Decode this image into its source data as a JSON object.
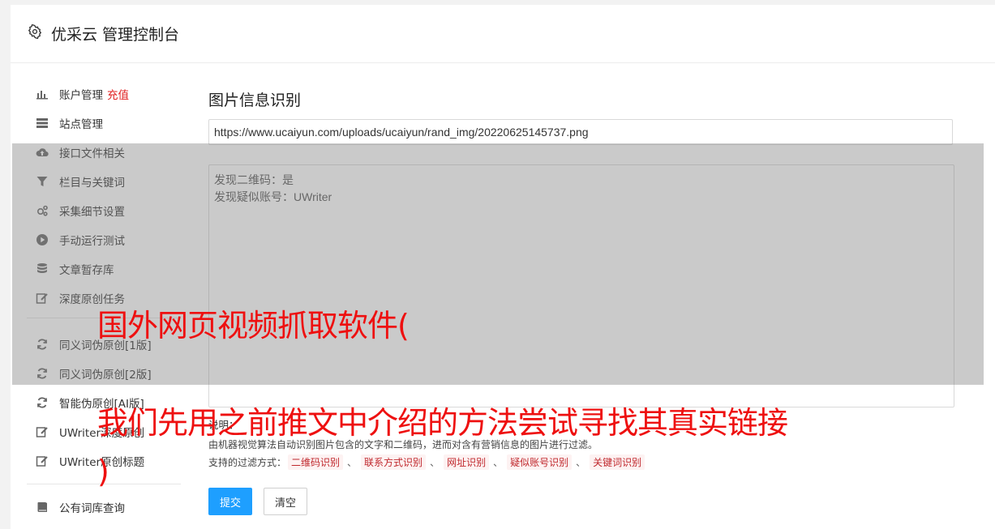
{
  "header": {
    "title": "优采云 管理控制台",
    "icon": "gear-icon"
  },
  "sidebar": {
    "items": [
      {
        "label": "账户管理",
        "badge": "充值",
        "icon": "bar-chart-icon"
      },
      {
        "label": "站点管理",
        "icon": "server-icon"
      },
      {
        "label": "接口文件相关",
        "icon": "cloud-upload-icon"
      },
      {
        "label": "栏目与关键词",
        "icon": "filter-icon"
      },
      {
        "label": "采集细节设置",
        "icon": "cogs-icon"
      },
      {
        "label": "手动运行测试",
        "icon": "play-circle-icon"
      },
      {
        "label": "文章暂存库",
        "icon": "database-icon"
      },
      {
        "label": "深度原创任务",
        "icon": "edit-icon"
      },
      {
        "label": "同义词伪原创[1版]",
        "icon": "refresh-icon"
      },
      {
        "label": "同义词伪原创[2版]",
        "icon": "refresh-icon"
      },
      {
        "label": "智能伪原创[AI版]",
        "icon": "refresh-icon"
      },
      {
        "label": "UWriter深度原创",
        "icon": "edit-icon"
      },
      {
        "label": "UWriter原创标题",
        "icon": "edit-icon"
      },
      {
        "label": "公有词库查询",
        "icon": "book-icon"
      }
    ]
  },
  "main": {
    "title": "图片信息识别",
    "url_value": "https://www.ucaiyun.com/uploads/ucaiyun/rand_img/20220625145737.png",
    "result_lines": [
      "发现二维码：是",
      "发现疑似账号：UWriter"
    ],
    "note_label": "说明：",
    "description": "由机器视觉算法自动识别图片包含的文字和二维码，进而对含有营销信息的图片进行过滤。",
    "filters_label": "支持的过滤方式：",
    "filters": [
      "二维码识别",
      "联系方式识别",
      "网址识别",
      "疑似账号识别",
      "关键词识别"
    ],
    "filter_separator": "、",
    "submit_label": "提交",
    "clear_label": "清空"
  },
  "overlay": {
    "line1": "国外网页视频抓取软件(",
    "line2": "我们先用之前推文中介绍的方法尝试寻找其真实链接",
    "line3": ")"
  },
  "colors": {
    "accent": "#1e9fff",
    "caption": "#ee1010",
    "badge": "#e02020",
    "tag_text": "#c0282d"
  }
}
